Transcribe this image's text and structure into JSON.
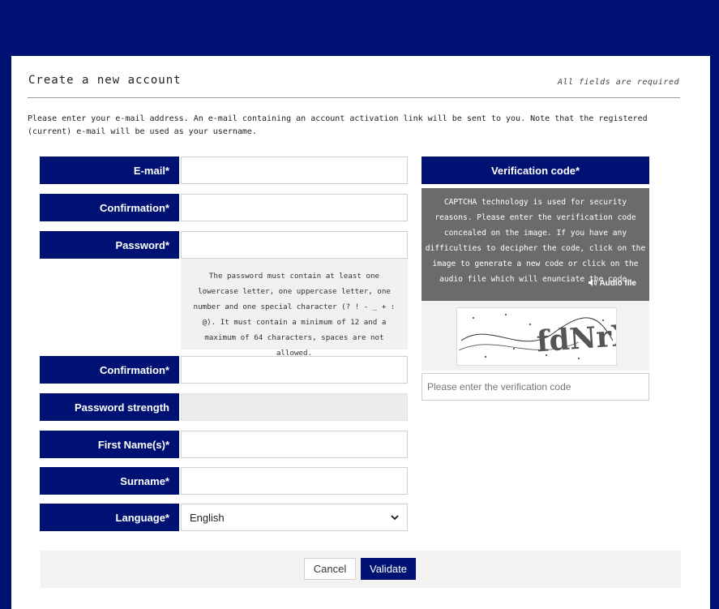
{
  "page": {
    "title": "Create a new account",
    "required_note": "All fields are required",
    "intro": "Please enter your e-mail address. An e-mail containing an account activation link will be sent to you. Note that the registered (current) e-mail will be used as your username."
  },
  "form": {
    "email_label": "E-mail*",
    "email_confirm_label": "Confirmation*",
    "password_label": "Password*",
    "password_hint": "The password must contain at least one lowercase letter, one uppercase letter, one number and one special character (? ! - _ + : @). It must contain a minimum of 12 and a maximum of 64 characters, spaces are not allowed.",
    "password_confirm_label": "Confirmation*",
    "password_strength_label": "Password strength",
    "first_name_label": "First Name(s)*",
    "surname_label": "Surname*",
    "language_label": "Language*",
    "language_value": "English"
  },
  "captcha": {
    "heading": "Verification code*",
    "description": "CAPTCHA technology is used for security reasons. Please enter the verification code concealed on the image. If you have any difficulties to decipher the code, click on the image to generate a new code or click on the audio file which will enunciate the code.",
    "audio_label": "Audio file",
    "image_text": "fdNrXr",
    "input_placeholder": "Please enter the verification code"
  },
  "buttons": {
    "cancel": "Cancel",
    "validate": "Validate"
  },
  "colors": {
    "primary": "#001174",
    "captcha_bg": "#6b6b6b"
  },
  "icons": {
    "audio": "speaker-icon",
    "select": "chevron-down-icon"
  }
}
